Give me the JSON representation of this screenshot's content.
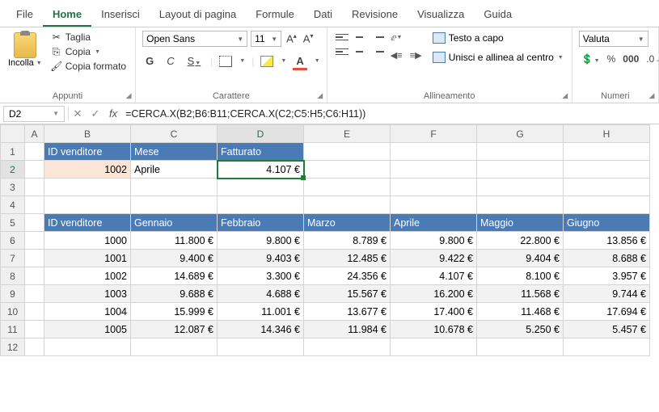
{
  "tabs": [
    "File",
    "Home",
    "Inserisci",
    "Layout di pagina",
    "Formule",
    "Dati",
    "Revisione",
    "Visualizza",
    "Guida"
  ],
  "activeTab": 1,
  "clipboard": {
    "paste": "Incolla",
    "cut": "Taglia",
    "copy": "Copia",
    "painter": "Copia formato",
    "group": "Appunti"
  },
  "font": {
    "name": "Open Sans",
    "size": "11",
    "group": "Carattere",
    "bold": "G",
    "italic": "C",
    "underline": "S"
  },
  "align": {
    "group": "Allineamento",
    "wrap": "Testo a capo",
    "merge": "Unisci e allinea al centro"
  },
  "number": {
    "group": "Numeri",
    "format": "Valuta"
  },
  "cellRef": "D2",
  "formula": "=CERCA.X(B2;B6:B11;CERCA.X(C2;C5:H5;C6:H11))",
  "cols": [
    "A",
    "B",
    "C",
    "D",
    "E",
    "F",
    "G",
    "H"
  ],
  "headers1": {
    "B": "ID venditore",
    "C": "Mese",
    "D": "Fatturato"
  },
  "row2": {
    "B": "1002",
    "C": "Aprile",
    "D": "4.107 €"
  },
  "headers5": {
    "B": "ID venditore",
    "C": "Gennaio",
    "D": "Febbraio",
    "E": "Marzo",
    "F": "Aprile",
    "G": "Maggio",
    "H": "Giugno"
  },
  "data": [
    {
      "B": "1000",
      "C": "11.800 €",
      "D": "9.800 €",
      "E": "8.789 €",
      "F": "9.800 €",
      "G": "22.800 €",
      "H": "13.856 €"
    },
    {
      "B": "1001",
      "C": "9.400 €",
      "D": "9.403 €",
      "E": "12.485 €",
      "F": "9.422 €",
      "G": "9.404 €",
      "H": "8.688 €"
    },
    {
      "B": "1002",
      "C": "14.689 €",
      "D": "3.300 €",
      "E": "24.356 €",
      "F": "4.107 €",
      "G": "8.100 €",
      "H": "3.957 €"
    },
    {
      "B": "1003",
      "C": "9.688 €",
      "D": "4.688 €",
      "E": "15.567 €",
      "F": "16.200 €",
      "G": "11.568 €",
      "H": "9.744 €"
    },
    {
      "B": "1004",
      "C": "15.999 €",
      "D": "11.001 €",
      "E": "13.677 €",
      "F": "17.400 €",
      "G": "11.468 €",
      "H": "17.694 €"
    },
    {
      "B": "1005",
      "C": "12.087 €",
      "D": "14.346 €",
      "E": "11.984 €",
      "F": "10.678 €",
      "G": "5.250 €",
      "H": "5.457 €"
    }
  ]
}
